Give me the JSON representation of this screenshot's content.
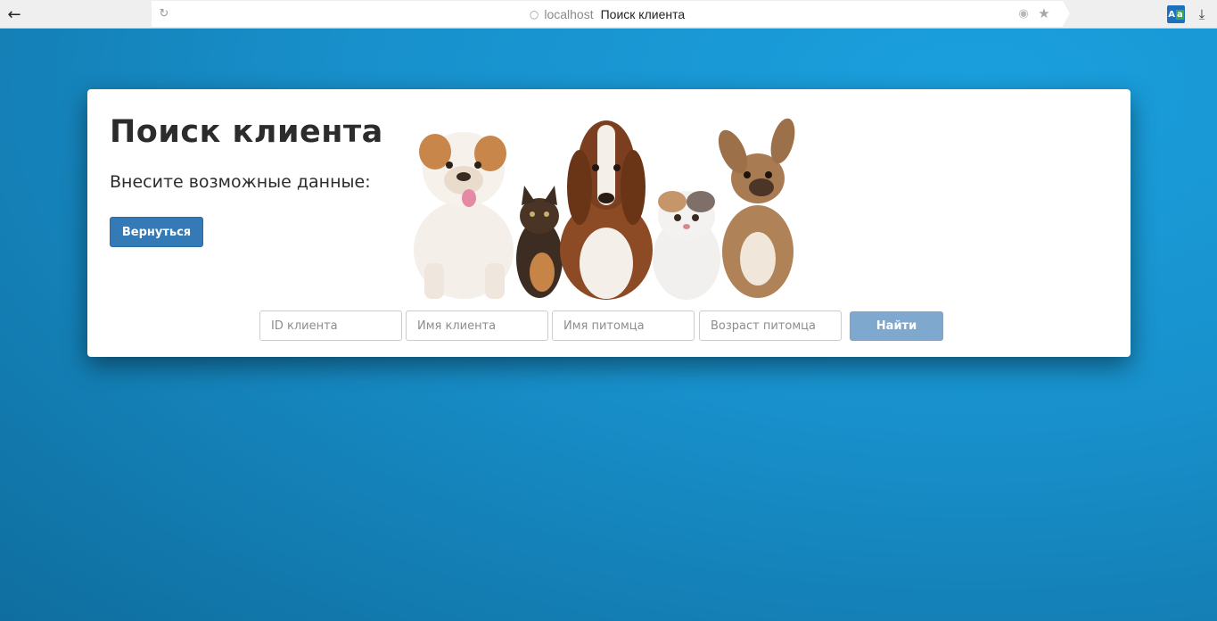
{
  "browser": {
    "host": "localhost",
    "tab_title": "Поиск клиента"
  },
  "colors": {
    "primary_button": "#337ab7",
    "disabled_button": "#7fa8cf",
    "background": "#1a8ac4"
  },
  "page": {
    "title": "Поиск клиента",
    "subtitle": "Внесите возможные данные:",
    "back_button": "Вернуться"
  },
  "search": {
    "client_id_placeholder": "ID клиента",
    "client_name_placeholder": "Имя клиента",
    "pet_name_placeholder": "Имя питомца",
    "pet_age_placeholder": "Возраст питомца",
    "find_button": "Найти"
  }
}
